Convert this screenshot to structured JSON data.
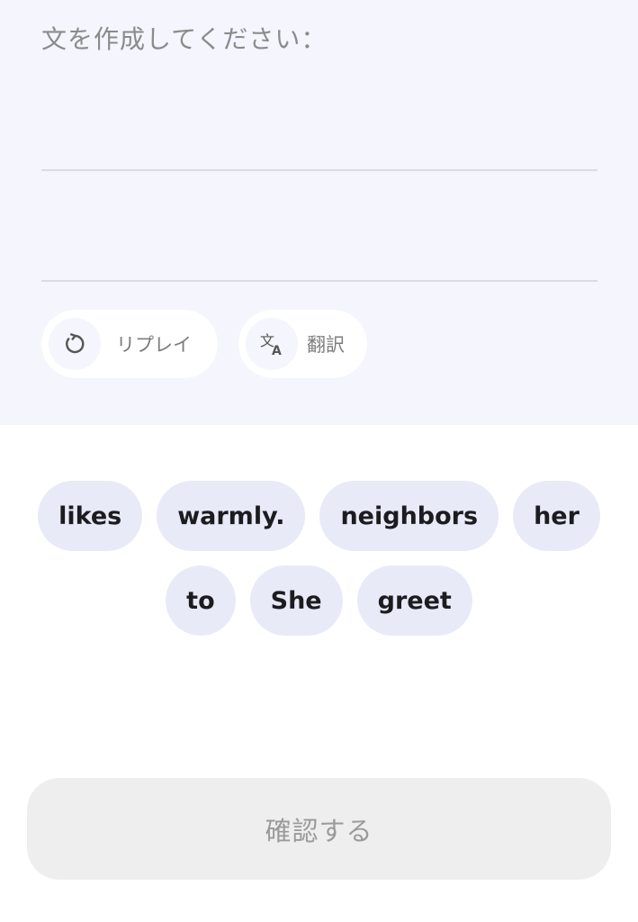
{
  "prompt": {
    "text": "文を作成してください："
  },
  "actions": {
    "replay_label": "リプレイ",
    "translate_label": "翻訳",
    "translate_glyph_main": "文",
    "translate_glyph_sub": "A"
  },
  "word_bank": {
    "row1": [
      "likes",
      "warmly.",
      "neighbors",
      "her"
    ],
    "row2": [
      "to",
      "She",
      "greet"
    ]
  },
  "confirm": {
    "label": "確認する"
  },
  "colors": {
    "panel_bg": "#f4f5fd",
    "chip_bg": "#e9eaf8",
    "confirm_bg": "#eeeeee"
  }
}
